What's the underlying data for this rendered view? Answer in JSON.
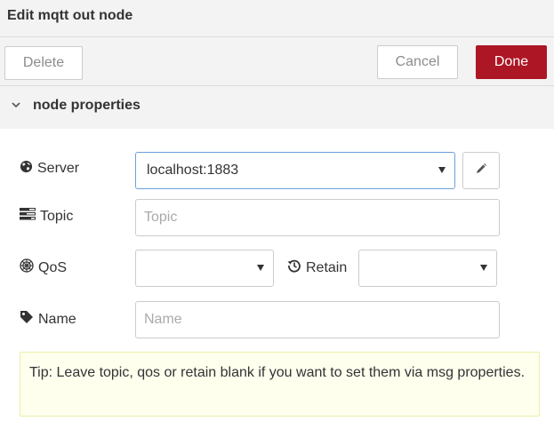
{
  "dialog": {
    "title": "Edit mqtt out node"
  },
  "toolbar": {
    "delete_label": "Delete",
    "cancel_label": "Cancel",
    "done_label": "Done"
  },
  "section": {
    "label": "node properties",
    "icon": "chevron-down-icon"
  },
  "form": {
    "server": {
      "label": "Server",
      "icon": "globe-icon",
      "value": "localhost:1883",
      "edit_icon": "pencil-icon"
    },
    "topic": {
      "label": "Topic",
      "icon": "tasks-icon",
      "placeholder": "Topic",
      "value": ""
    },
    "qos": {
      "label": "QoS",
      "icon": "empire-icon",
      "value": ""
    },
    "retain": {
      "label": "Retain",
      "icon": "history-icon",
      "value": ""
    },
    "name": {
      "label": "Name",
      "icon": "tag-icon",
      "placeholder": "Name",
      "value": ""
    }
  },
  "tip": {
    "text": "Tip: Leave topic, qos or retain blank if you want to set them via msg properties."
  },
  "colors": {
    "done_bg": "#ad1625",
    "panel_bg": "#f3f3f3",
    "tip_bg": "#ffffee",
    "focus_border": "#6aa0d8"
  }
}
